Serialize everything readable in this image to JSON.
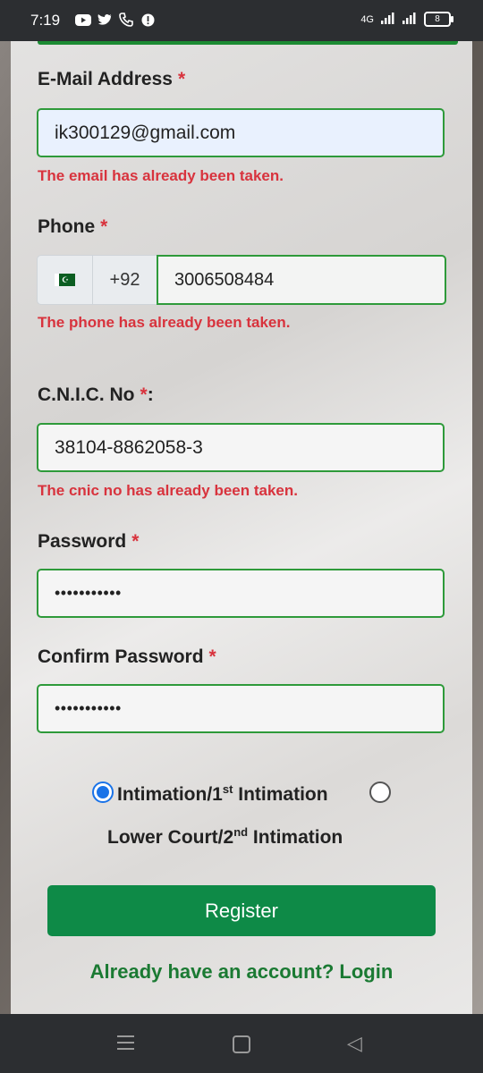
{
  "status_bar": {
    "time": "7:19",
    "left_icons": [
      "youtube-icon",
      "twitter-icon",
      "phone-icon",
      "alert-icon"
    ],
    "network": "4G",
    "battery": "8"
  },
  "form": {
    "email": {
      "label": "E-Mail Address",
      "required_mark": "*",
      "value": "ik300129@gmail.com",
      "error": "The email has already been taken."
    },
    "phone": {
      "label": "Phone",
      "required_mark": "*",
      "country_code": "+92",
      "value": "3006508484",
      "error": "The phone has already been taken."
    },
    "cnic": {
      "label": "C.N.I.C. No",
      "required_mark": "*",
      "colon": ":",
      "value": "38104-8862058-3",
      "error": "The cnic no has already been taken."
    },
    "password": {
      "label": "Password",
      "required_mark": "*",
      "masked_value": "•••••••••••"
    },
    "confirm_password": {
      "label": "Confirm Password",
      "required_mark": "*",
      "masked_value": "•••••••••••"
    },
    "intimation": {
      "option1_text": "Intimation/1",
      "option1_sup": "st",
      "option1_suffix": " Intimation",
      "option1_selected": true,
      "option2_text": "Lower Court/2",
      "option2_sup": "nd",
      "option2_suffix": " Intimation",
      "option2_selected": false
    },
    "register_label": "Register",
    "login_link": "Already have an account? Login"
  },
  "colors": {
    "accent_green": "#0e8a47",
    "error_red": "#d8333d",
    "radio_blue": "#1a73e8"
  }
}
